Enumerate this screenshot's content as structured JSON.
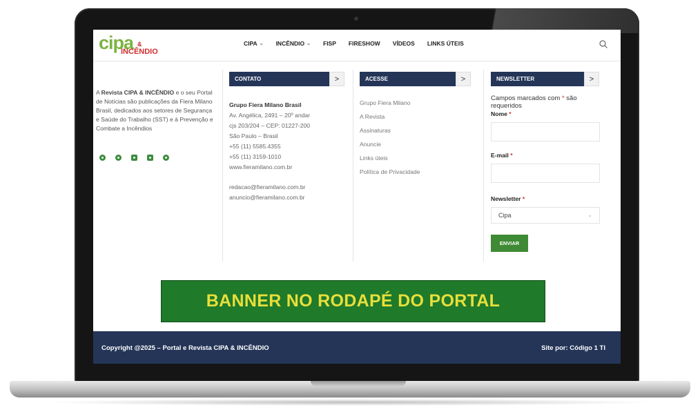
{
  "header": {
    "logo": {
      "primary": "cipa",
      "amp": "&",
      "secondary": "INCÊNDIO"
    },
    "nav": [
      {
        "label": "CIPA",
        "dropdown": true
      },
      {
        "label": "INCÊNDIO",
        "dropdown": true
      },
      {
        "label": "FISP",
        "dropdown": false
      },
      {
        "label": "FIRESHOW",
        "dropdown": false
      },
      {
        "label": "VÍDEOS",
        "dropdown": false
      },
      {
        "label": "LINKS ÚTEIS",
        "dropdown": false
      }
    ],
    "search_icon": "search-icon"
  },
  "about": {
    "prefix": "A ",
    "brand": "Revista CIPA & INCÊNDIO",
    "body": " e o seu Portal de Notícias são publicações da Fiera Milano Brasil, dedicados aos setores de Segurança e Saúde do Trabalho (SST) e à Prevenção e Combate a Incêndios",
    "social_icons": [
      "instagram-icon",
      "whatsapp-icon",
      "linkedin-icon",
      "youtube-icon",
      "spotify-icon"
    ]
  },
  "contact": {
    "title": "CONTATO",
    "arrow": ">",
    "company": "Grupo Fiera Milano Brasil",
    "lines": [
      "Av. Angélica, 2491 – 20º andar",
      "cjs 203/204 – CEP: 01227-200",
      "São Paulo – Brasil",
      "+55 (11) 5585.4355",
      "+55 (11) 3159-1010",
      "www.fieramilano.com.br"
    ],
    "emails": [
      "redacao@fieramilano.com.br",
      "anuncio@fieramilano.com.br"
    ]
  },
  "access": {
    "title": "ACESSE",
    "arrow": ">",
    "links": [
      "Grupo Fiera Milano",
      "A Revista",
      "Assinaturas",
      "Anuncie",
      "Links úteis",
      "Política de Privacidade"
    ]
  },
  "newsletter": {
    "title": "NEWSLETTER",
    "arrow": ">",
    "required_note": "Campos marcados com",
    "required_star": "*",
    "required_suffix": "são requeridos",
    "name_label": "Nome",
    "email_label": "E-mail",
    "newsletter_label": "Newsletter",
    "select_value": "Cipa",
    "send_label": "ENVIAR"
  },
  "banner": {
    "text": "BANNER NO RODAPÉ DO PORTAL"
  },
  "footer": {
    "copyright": "Copyright @2025  – Portal e Revista CIPA & INCÊNDIO",
    "credit": "Site por: Código 1 TI"
  },
  "colors": {
    "navy": "#243558",
    "green": "#3f8a35",
    "banner_green": "#1f7a2a",
    "banner_text": "#e8df3a",
    "logo_green": "#7cb342",
    "logo_red": "#d32f2f"
  }
}
